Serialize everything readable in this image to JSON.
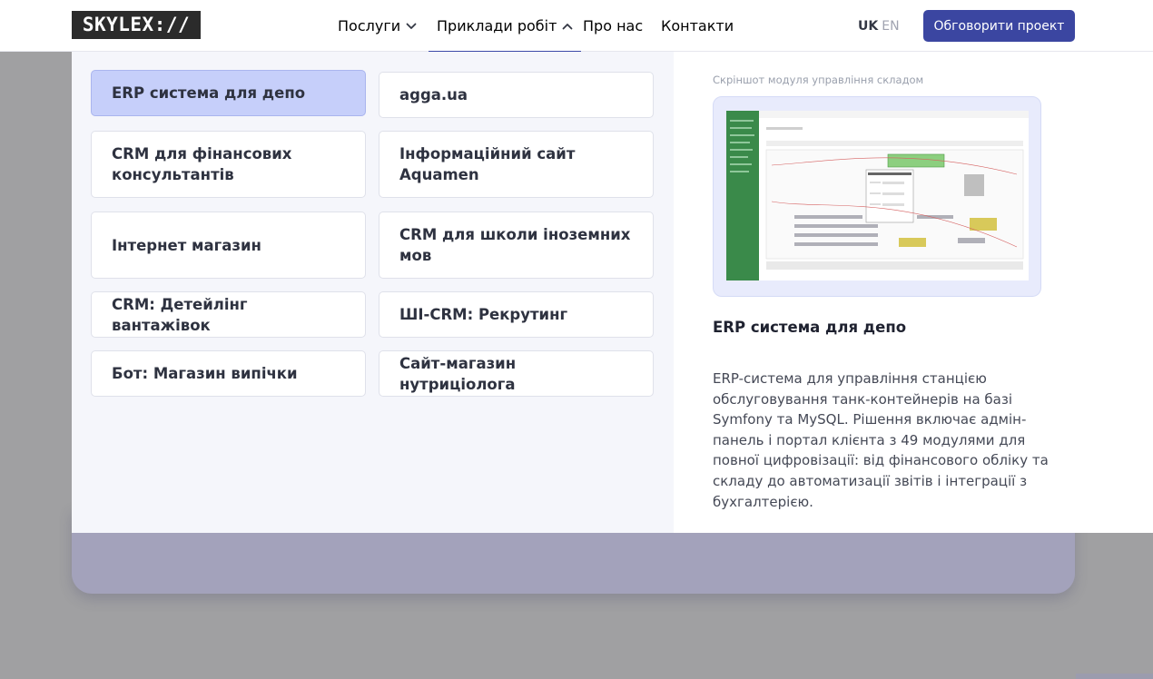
{
  "brand": {
    "logo_text": "SKYLEX://"
  },
  "nav": {
    "items": [
      {
        "label": "Послуги"
      },
      {
        "label": "Приклади робіт"
      },
      {
        "label": "Про нас"
      },
      {
        "label": "Контакти"
      }
    ],
    "active": "Приклади робіт"
  },
  "lang": {
    "uk": "UK",
    "en": "EN",
    "current": "UK"
  },
  "cta": {
    "label": "Обговорити проект"
  },
  "projects": [
    {
      "label": "ERP система для депо",
      "selected": true
    },
    {
      "label": "agga.ua"
    },
    {
      "label": "CRM для фінансових консультантів"
    },
    {
      "label": "Інформаційний сайт Aquamen"
    },
    {
      "label": "Інтернет магазин"
    },
    {
      "label": "CRM для школи іноземних мов"
    },
    {
      "label": "CRM: Детейлінг вантажівок"
    },
    {
      "label": "ШІ-CRM: Рекрутинг"
    },
    {
      "label": "Бот: Магазин випічки"
    },
    {
      "label": "Сайт-магазин нутриціолога"
    }
  ],
  "preview": {
    "caption": "Скріншот модуля управління складом",
    "title": "ERP система для депо",
    "description": "ERP-система для управління станцією обслуговування танк-контейнерів на базі Symfony та MySQL. Рішення включає адмін-панель і портал клієнта з 49 модулями для повної цифровізації: від фінансового обліку та складу до автоматизації звітів і інтеграції з бухгалтерією."
  },
  "colors": {
    "accent": "#3b46a1",
    "selected_card": "#c6cffa",
    "overlay": "#a0a0a2",
    "sidebar_green": "#3a8a4a"
  }
}
